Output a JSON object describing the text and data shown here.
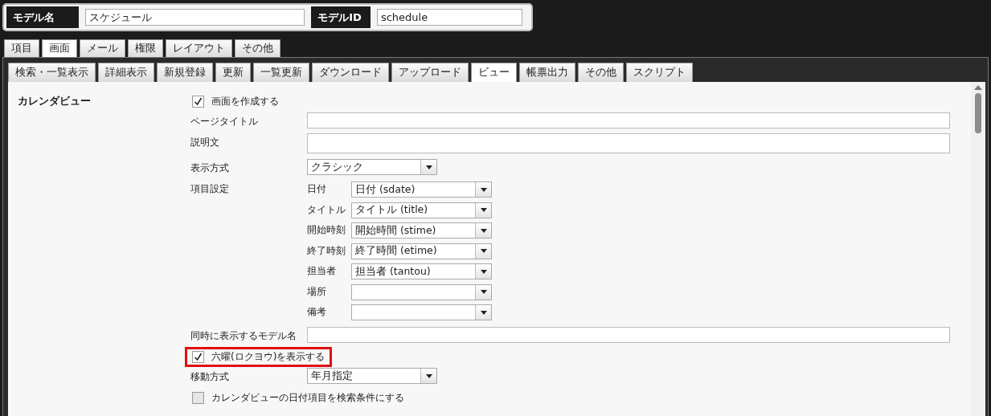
{
  "header": {
    "fields": [
      {
        "label": "モデル名",
        "value": "スケジュール"
      },
      {
        "label": "モデルID",
        "value": "schedule"
      }
    ]
  },
  "main_tabs": [
    {
      "label": "項目",
      "selected": false
    },
    {
      "label": "画面",
      "selected": true
    },
    {
      "label": "メール",
      "selected": false
    },
    {
      "label": "権限",
      "selected": false
    },
    {
      "label": "レイアウト",
      "selected": false
    },
    {
      "label": "その他",
      "selected": false
    }
  ],
  "sub_tabs": [
    {
      "label": "検索・一覧表示",
      "selected": false
    },
    {
      "label": "詳細表示",
      "selected": false
    },
    {
      "label": "新規登録",
      "selected": false
    },
    {
      "label": "更新",
      "selected": false
    },
    {
      "label": "一覧更新",
      "selected": false
    },
    {
      "label": "ダウンロード",
      "selected": false
    },
    {
      "label": "アップロード",
      "selected": false
    },
    {
      "label": "ビュー",
      "selected": true
    },
    {
      "label": "帳票出力",
      "selected": false
    },
    {
      "label": "その他",
      "selected": false
    },
    {
      "label": "スクリプト",
      "selected": false
    }
  ],
  "section": {
    "title": "カレンダビュー",
    "rows": [
      {
        "kind": "checkbox",
        "label": "画面を作成する",
        "checked": true,
        "highlighted": false
      },
      {
        "kind": "text",
        "label": "ページタイトル"
      },
      {
        "kind": "textarea",
        "label": "説明文"
      },
      {
        "kind": "select",
        "label": "表示方式",
        "value": "クラシック"
      },
      {
        "kind": "mapping",
        "label": "項目設定",
        "items": [
          {
            "label": "日付",
            "value": "日付 (sdate)"
          },
          {
            "label": "タイトル",
            "value": "タイトル (title)"
          },
          {
            "label": "開始時刻",
            "value": "開始時間 (stime)"
          },
          {
            "label": "終了時刻",
            "value": "終了時間 (etime)"
          },
          {
            "label": "担当者",
            "value": "担当者 (tantou)"
          },
          {
            "label": "場所"
          },
          {
            "label": "備考"
          }
        ]
      },
      {
        "kind": "text",
        "label": "同時に表示するモデル名"
      },
      {
        "kind": "checkbox",
        "label": "六曜(ロクヨウ)を表示する",
        "checked": true,
        "highlighted": true
      },
      {
        "kind": "select",
        "label": "移動方式",
        "value": "年月指定"
      },
      {
        "kind": "checkbox",
        "label": "カレンダビューの日付項目を検索条件にする",
        "checked": false,
        "highlighted": false
      }
    ]
  }
}
